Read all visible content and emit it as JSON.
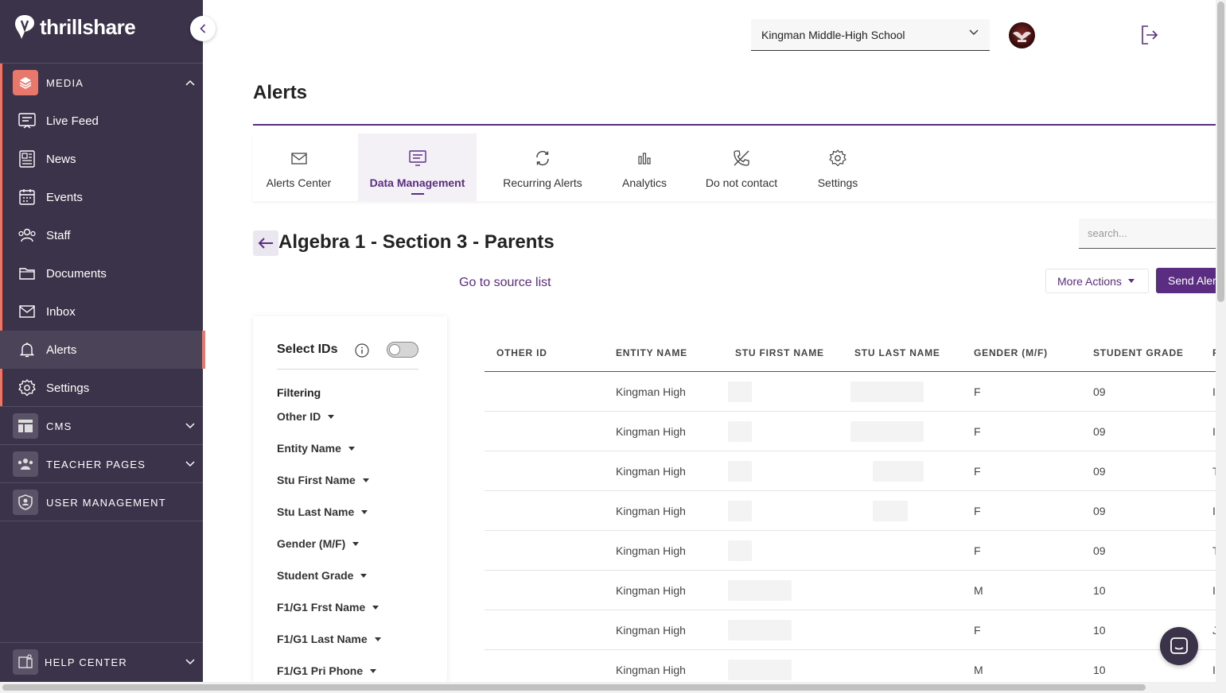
{
  "brand": {
    "name": "thrillshare",
    "accent": "#5b2d82",
    "sidebar_bg": "#3a3349",
    "highlight": "#e8786c"
  },
  "sidebar": {
    "media_label": "MEDIA",
    "media_items": [
      {
        "label": "Live Feed",
        "icon": "live-feed-icon"
      },
      {
        "label": "News",
        "icon": "news-icon"
      },
      {
        "label": "Events",
        "icon": "calendar-icon"
      },
      {
        "label": "Staff",
        "icon": "staff-icon"
      },
      {
        "label": "Documents",
        "icon": "folder-icon"
      },
      {
        "label": "Inbox",
        "icon": "envelope-icon"
      },
      {
        "label": "Alerts",
        "icon": "bell-icon",
        "active": true
      },
      {
        "label": "Settings",
        "icon": "gear-icon"
      }
    ],
    "cms_label": "CMS",
    "teacher_pages_label": "TEACHER PAGES",
    "user_management_label": "USER MANAGEMENT",
    "help_center_label": "HELP CENTER"
  },
  "topbar": {
    "school": "Kingman Middle-High School"
  },
  "page": {
    "title": "Alerts"
  },
  "tabs": [
    {
      "label": "Alerts Center",
      "icon": "envelope-icon"
    },
    {
      "label": "Data Management",
      "icon": "data-icon",
      "active": true
    },
    {
      "label": "Recurring Alerts",
      "icon": "refresh-icon"
    },
    {
      "label": "Analytics",
      "icon": "bar-chart-icon"
    },
    {
      "label": "Do not contact",
      "icon": "no-phone-icon"
    },
    {
      "label": "Settings",
      "icon": "gear-icon"
    }
  ],
  "list": {
    "title": "Algebra 1 - Section 3 - Parents",
    "source_link": "Go to source list",
    "search_placeholder": "search...",
    "more_actions": "More Actions",
    "send_alert": "Send Alert"
  },
  "filter_panel": {
    "select_ids": "Select IDs",
    "filtering": "Filtering",
    "filters": [
      "Other ID",
      "Entity Name",
      "Stu First Name",
      "Stu Last Name",
      "Gender (M/F)",
      "Student Grade",
      "F1/G1 Frst Name",
      "F1/G1 Last Name",
      "F1/G1 Pri Phone"
    ]
  },
  "table": {
    "headers": [
      "OTHER ID",
      "ENTITY NAME",
      "STU FIRST NAME",
      "STU LAST NAME",
      "GENDER (M/F)",
      "STUDENT GRADE",
      "F"
    ],
    "rows": [
      {
        "entity": "Kingman High",
        "gender": "F",
        "grade": "09",
        "next": "I"
      },
      {
        "entity": "Kingman High",
        "gender": "F",
        "grade": "09",
        "next": "I"
      },
      {
        "entity": "Kingman High",
        "gender": "F",
        "grade": "09",
        "next": "T"
      },
      {
        "entity": "Kingman High",
        "gender": "F",
        "grade": "09",
        "next": "I"
      },
      {
        "entity": "Kingman High",
        "gender": "F",
        "grade": "09",
        "next": "T"
      },
      {
        "entity": "Kingman High",
        "gender": "M",
        "grade": "10",
        "next": "I"
      },
      {
        "entity": "Kingman High",
        "gender": "F",
        "grade": "10",
        "next": "J"
      },
      {
        "entity": "Kingman High",
        "gender": "M",
        "grade": "10",
        "next": "I"
      }
    ]
  }
}
